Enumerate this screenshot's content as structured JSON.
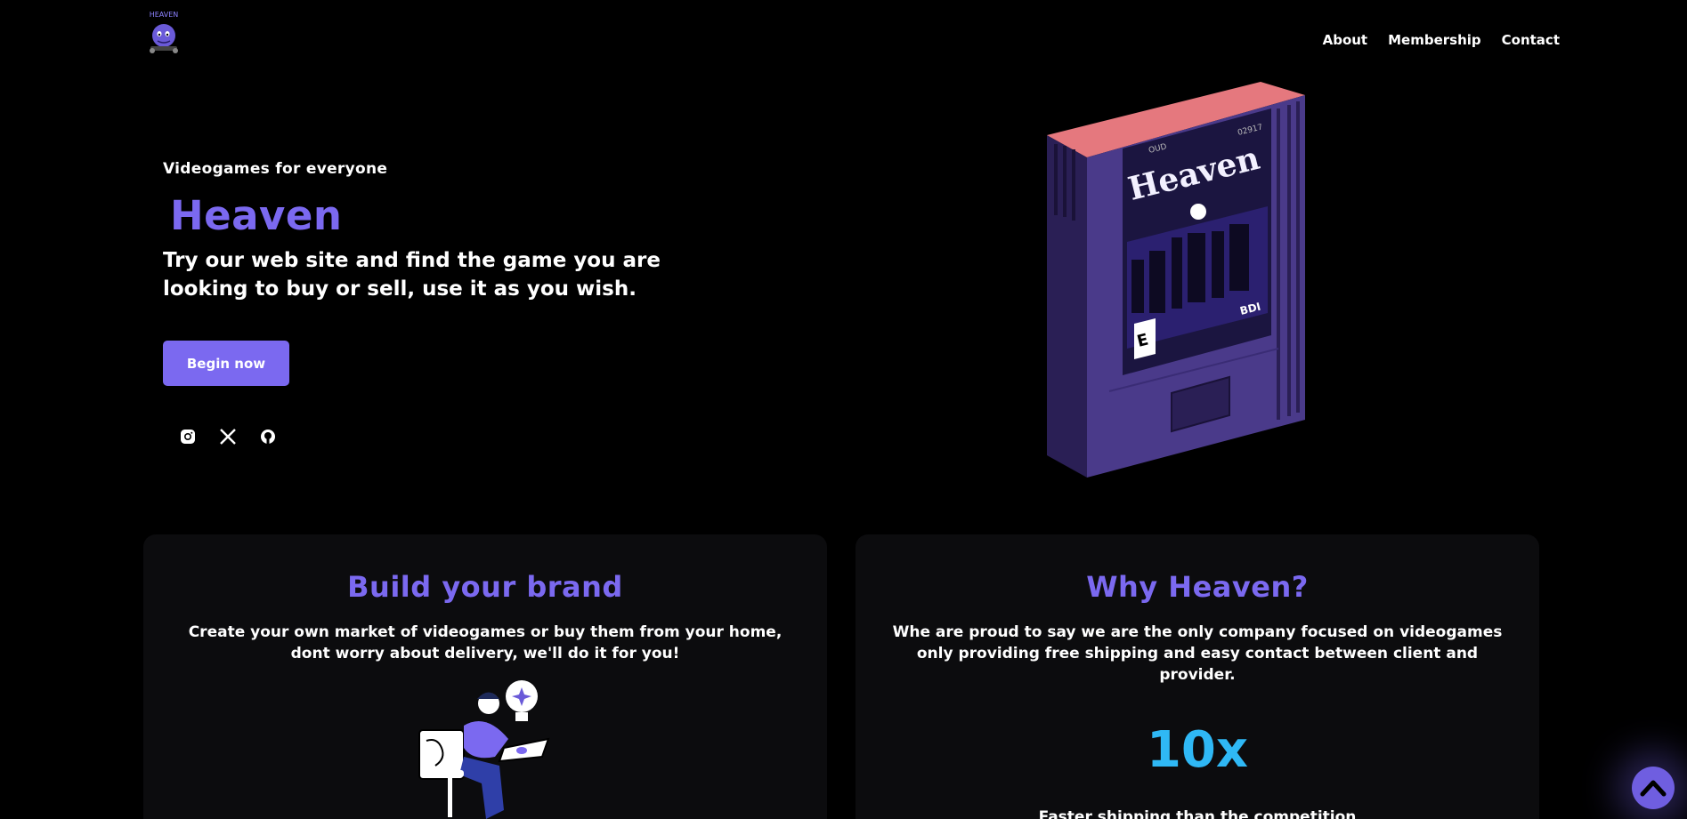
{
  "header": {
    "logo_text": "HEAVEN",
    "nav": [
      {
        "label": "About"
      },
      {
        "label": "Membership"
      },
      {
        "label": "Contact"
      }
    ]
  },
  "hero": {
    "eyebrow": "Videogames for everyone",
    "title": "Heaven",
    "subtitle": "Try our web site and find the game you are looking to buy or sell, use it as you wish.",
    "cta_label": "Begin now",
    "socials": [
      "instagram-icon",
      "x-icon",
      "github-icon"
    ],
    "cartridge": {
      "title": "Heaven",
      "top_left": "OUD",
      "top_right": "02917",
      "rating": "E",
      "badge": "BDI"
    }
  },
  "cards": {
    "brand": {
      "title": "Build your brand",
      "text": "Create your own market of videogames or buy them from your home, dont worry about delivery, we'll do it for you!"
    },
    "why": {
      "title": "Why Heaven?",
      "text": "Whe are proud to say we are the only company focused on videogames only providing free shipping and easy contact between client and provider.",
      "stat": "10x",
      "stat_caption": "Faster shipping than the competition"
    }
  },
  "colors": {
    "accent": "#7b69f0",
    "stat": "#2fb8f5",
    "background": "#000000",
    "card": "#0c0c0e"
  }
}
